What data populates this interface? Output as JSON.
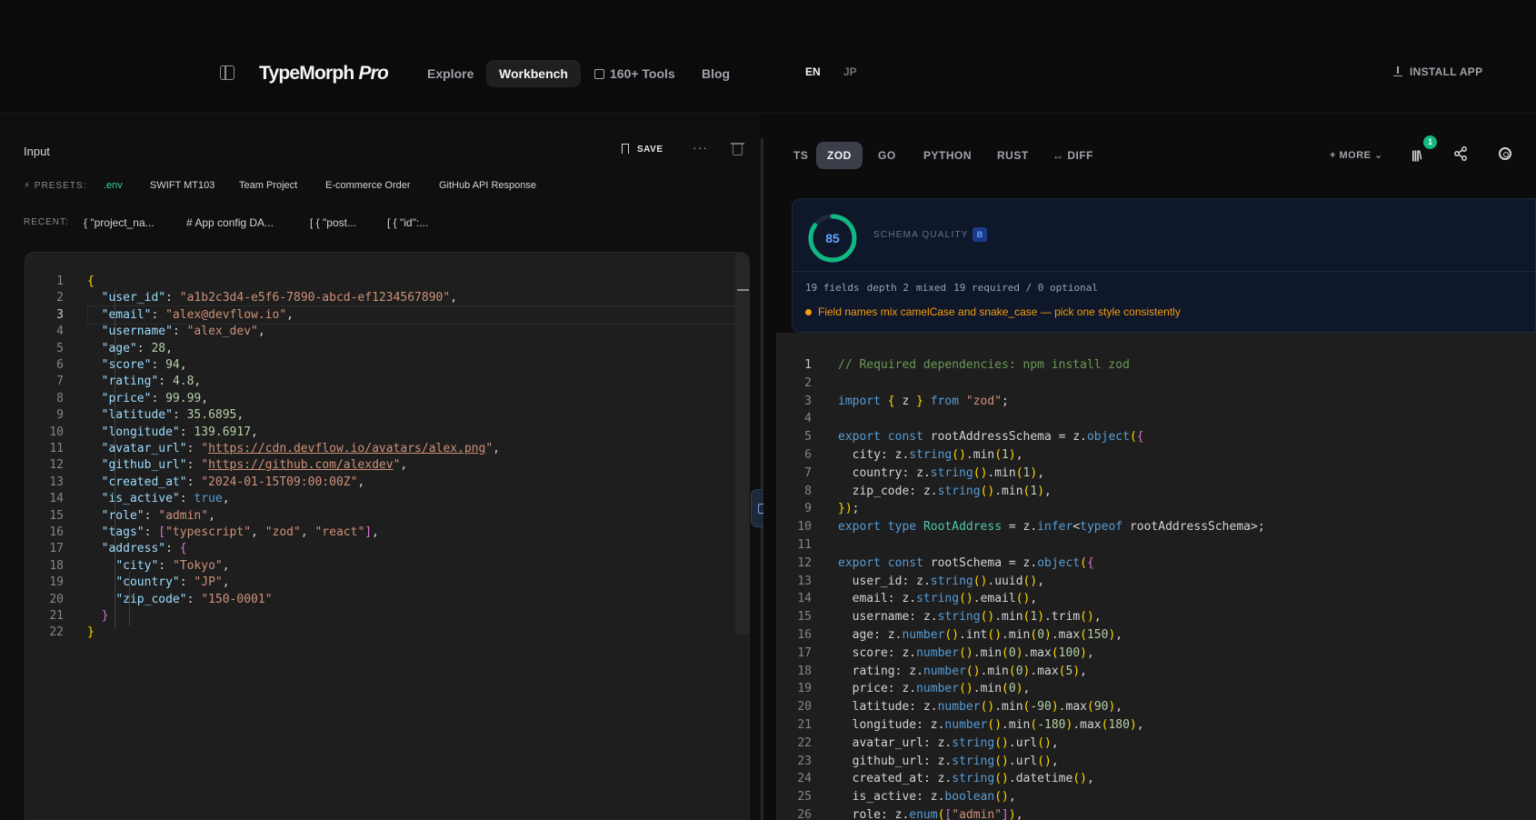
{
  "app": {
    "brand": "TypeMorph",
    "brand_suffix": "Pro"
  },
  "nav": [
    {
      "label": "Explore"
    },
    {
      "label": "Workbench"
    },
    {
      "label": "160+ Tools"
    },
    {
      "label": "Blog"
    }
  ],
  "langs": [
    "EN",
    "JP"
  ],
  "install_label": "INSTALL APP",
  "input_panel": {
    "title": "Input",
    "save_label": "SAVE",
    "more_label": "···",
    "presets_label": "PRESETS:",
    "presets": [
      ".env",
      "SWIFT MT103",
      "Team Project",
      "E-commerce Order",
      "GitHub API Response"
    ],
    "recent_label": "RECENT:",
    "recent": [
      "{ \"project_na...",
      "# App config DA...",
      "[ { \"post...",
      "[ { \"id\":..."
    ]
  },
  "output_tabs": [
    "TS",
    "ZOD",
    "GO",
    "PYTHON",
    "RUST",
    "DIFF"
  ],
  "more_tab": "+ MORE",
  "library_badge": "1",
  "quality": {
    "score": "85",
    "score_fraction": 0.85,
    "label": "SCHEMA QUALITY",
    "grade": "B",
    "stats": [
      "19 fields",
      "depth 2",
      "mixed",
      "19 required / 0 optional"
    ],
    "warning": "Field names mix camelCase and snake_case — pick one style consistently"
  },
  "colors": {
    "accent_green": "#10b981",
    "quality_blue": "#60a5fa",
    "warning": "#f59e0b"
  },
  "input_lines": [
    "{",
    "  \"user_id\": \"a1b2c3d4-e5f6-7890-abcd-ef1234567890\",",
    "  \"email\": \"alex@devflow.io\",",
    "  \"username\": \"alex_dev\",",
    "  \"age\": 28,",
    "  \"score\": 94,",
    "  \"rating\": 4.8,",
    "  \"price\": 99.99,",
    "  \"latitude\": 35.6895,",
    "  \"longitude\": 139.6917,",
    "  \"avatar_url\": \"https://cdn.devflow.io/avatars/alex.png\",",
    "  \"github_url\": \"https://github.com/alexdev\",",
    "  \"created_at\": \"2024-01-15T09:00:00Z\",",
    "  \"is_active\": true,",
    "  \"role\": \"admin\",",
    "  \"tags\": [\"typescript\", \"zod\", \"react\"],",
    "  \"address\": {",
    "    \"city\": \"Tokyo\",",
    "    \"country\": \"JP\",",
    "    \"zip_code\": \"150-0001\"",
    "  }",
    "}"
  ],
  "output_lines": [
    "// Required dependencies: npm install zod",
    "",
    "import { z } from \"zod\";",
    "",
    "export const rootAddressSchema = z.object({",
    "  city: z.string().min(1),",
    "  country: z.string().min(1),",
    "  zip_code: z.string().min(1),",
    "});",
    "export type RootAddress = z.infer<typeof rootAddressSchema>;",
    "",
    "export const rootSchema = z.object({",
    "  user_id: z.string().uuid(),",
    "  email: z.string().email(),",
    "  username: z.string().min(1).trim(),",
    "  age: z.number().int().min(0).max(150),",
    "  score: z.number().min(0).max(100),",
    "  rating: z.number().min(0).max(5),",
    "  price: z.number().min(0),",
    "  latitude: z.number().min(-90).max(90),",
    "  longitude: z.number().min(-180).max(180),",
    "  avatar_url: z.string().url(),",
    "  github_url: z.string().url(),",
    "  created_at: z.string().datetime(),",
    "  is_active: z.boolean(),",
    "  role: z.enum([\"admin\"]),"
  ]
}
